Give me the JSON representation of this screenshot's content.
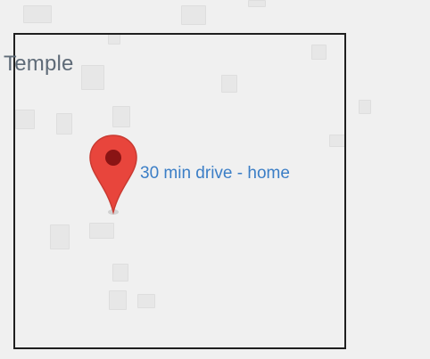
{
  "map": {
    "place_label": "Temple",
    "marker": {
      "icon": "map-pin-icon",
      "label": "30 min drive - home",
      "color": "#e8453c",
      "dot_color": "#8a1414"
    },
    "label_color": "#3b7ec6",
    "place_label_color": "#5f6b78"
  }
}
